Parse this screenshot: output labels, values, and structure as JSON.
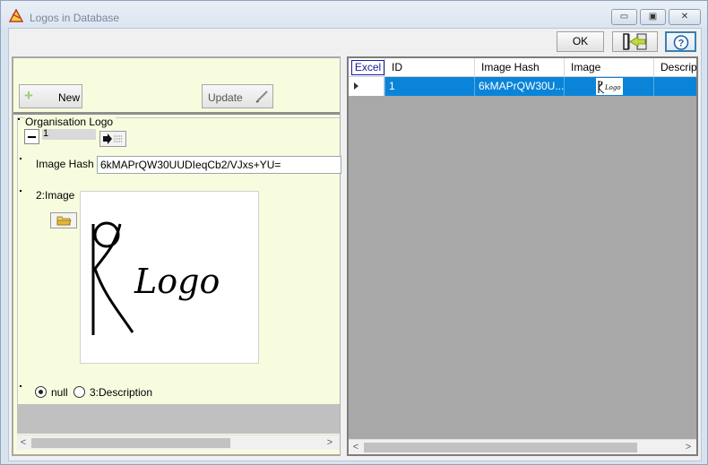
{
  "window": {
    "title": "Logos in Database",
    "controls": {
      "minimize": "▭",
      "maximize": "▣",
      "close": "✕"
    }
  },
  "toolbar": {
    "ok_label": "OK",
    "help_label": "?"
  },
  "form": {
    "new_label": "New",
    "update_label": "Update",
    "group_title": "Organisation Logo",
    "id_value": "1",
    "hash_label": "Image Hash",
    "hash_value": "6kMAPrQW30UUDIeqCb2/VJxs+YU=",
    "image_label": "2:Image",
    "logo_text": "Logo",
    "radio_null_label": "null",
    "radio_desc_label": "3:Description"
  },
  "grid": {
    "excel_label": "Excel",
    "columns": [
      "ID",
      "Image Hash",
      "Image",
      "Descriptio"
    ],
    "rows": [
      {
        "id": "1",
        "hash": "6kMAPrQW30U...",
        "image_text": "Logo"
      }
    ]
  },
  "colors": {
    "form_bg": "#f8fcdf",
    "selection": "#0a84d8",
    "grid_bg": "#a8a8a8"
  }
}
